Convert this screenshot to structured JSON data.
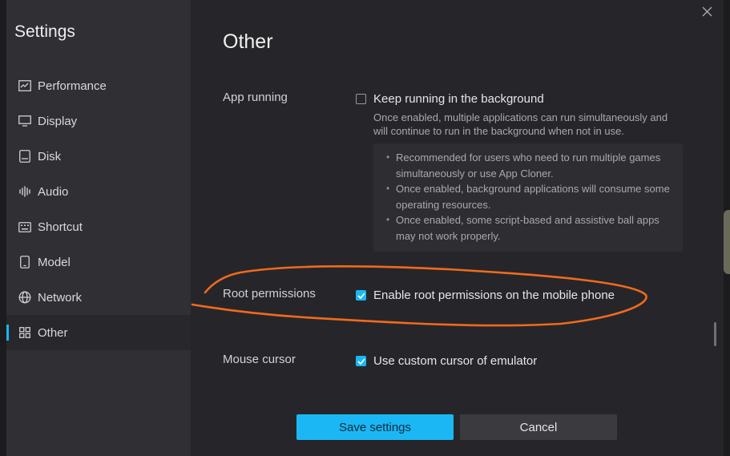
{
  "sidebar": {
    "title": "Settings",
    "items": [
      {
        "label": "Performance",
        "icon": "performance-icon"
      },
      {
        "label": "Display",
        "icon": "display-icon"
      },
      {
        "label": "Disk",
        "icon": "disk-icon"
      },
      {
        "label": "Audio",
        "icon": "audio-icon"
      },
      {
        "label": "Shortcut",
        "icon": "keyboard-icon"
      },
      {
        "label": "Model",
        "icon": "phone-icon"
      },
      {
        "label": "Network",
        "icon": "globe-icon"
      },
      {
        "label": "Other",
        "icon": "grid-icon",
        "active": true
      }
    ]
  },
  "main": {
    "title": "Other",
    "app_running": {
      "label": "App running",
      "option": "Keep running in the background",
      "checked": false,
      "description": "Once enabled, multiple applications can run simultaneously and will continue to run in the background when not in use.",
      "notes": [
        "Recommended for users who need to run multiple games simultaneously or use App Cloner.",
        "Once enabled, background applications will consume some operating resources.",
        "Once enabled, some script-based and assistive ball apps may not work properly."
      ]
    },
    "root_permissions": {
      "label": "Root permissions",
      "option": "Enable root permissions on the mobile phone",
      "checked": true
    },
    "mouse_cursor": {
      "label": "Mouse cursor",
      "option": "Use custom cursor of emulator",
      "checked": true
    }
  },
  "buttons": {
    "save": "Save settings",
    "cancel": "Cancel"
  },
  "colors": {
    "accent": "#1bb7f5",
    "annotation": "#f26a1b"
  }
}
